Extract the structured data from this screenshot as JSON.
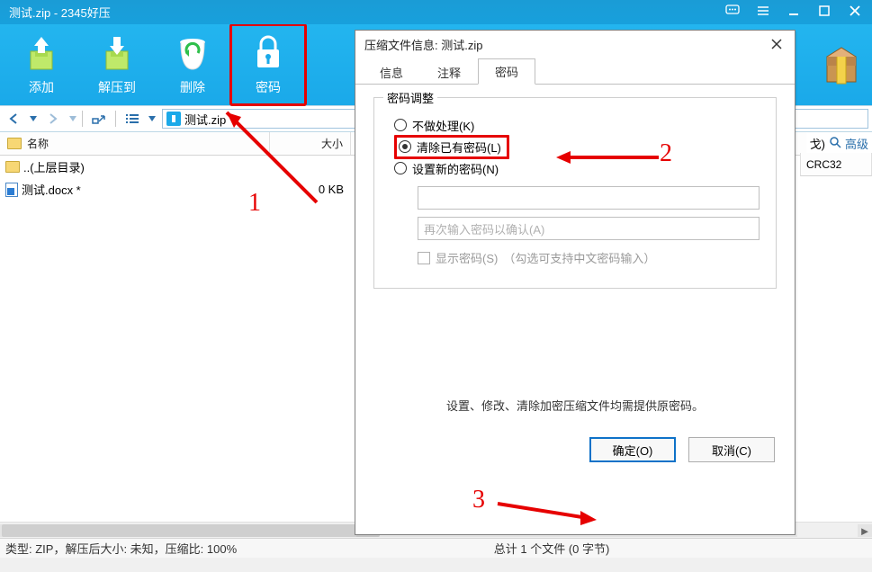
{
  "window": {
    "title": "测试.zip - 2345好压"
  },
  "toolbar": {
    "add": "添加",
    "extract": "解压到",
    "delete": "删除",
    "password": "密码"
  },
  "address": {
    "path": "测试.zip"
  },
  "grid": {
    "col_name": "名称",
    "col_size": "大小",
    "col_crc": "CRC32",
    "rows": [
      {
        "name": "..(上层目录)",
        "size": ""
      },
      {
        "name": "测试.docx *",
        "size": "0 KB"
      }
    ]
  },
  "find": {
    "hint1": "戈)",
    "hint2": "高级"
  },
  "status": {
    "left": "类型:  ZIP，解压后大小:  未知，压缩比:  100%",
    "mid": "总计 1 个文件 (0 字节)"
  },
  "dialog": {
    "title": "压缩文件信息: 测试.zip",
    "tabs": {
      "info": "信息",
      "comment": "注释",
      "password": "密码"
    },
    "group_legend": "密码调整",
    "opt_none": "不做处理(K)",
    "opt_clear": "清除已有密码(L)",
    "opt_set": "设置新的密码(N)",
    "pw_confirm_placeholder": "再次输入密码以确认(A)",
    "chk_show": "显示密码(S)",
    "chk_hint": "（勾选可支持中文密码输入）",
    "note": "设置、修改、清除加密压缩文件均需提供原密码。",
    "ok": "确定(O)",
    "cancel": "取消(C)"
  },
  "annotations": {
    "n1": "1",
    "n2": "2",
    "n3": "3"
  }
}
